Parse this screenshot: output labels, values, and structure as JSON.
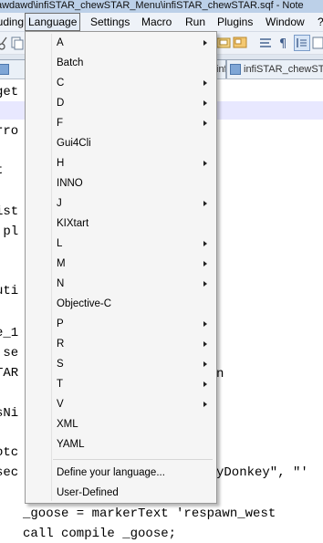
{
  "window": {
    "title": "awdawd\\infiSTAR_chewSTAR_Menu\\infiSTAR_chewSTAR.sqf - Note"
  },
  "menubar": {
    "items": [
      {
        "label": "luding"
      },
      {
        "label": "Language"
      },
      {
        "label": "Settings"
      },
      {
        "label": "Macro"
      },
      {
        "label": "Run"
      },
      {
        "label": "Plugins"
      },
      {
        "label": "Window"
      },
      {
        "label": "?"
      }
    ]
  },
  "tabs": [
    {
      "label": "infiSTAR_chewSTAR..."
    },
    {
      "label": "infiSTAR_chewST"
    }
  ],
  "editor": {
    "lines": [
      "get",
      "",
      "rro",
      "",
      "t",
      "",
      "ist",
      " pl",
      "",
      "",
      "uti",
      "",
      "e_1",
      " se",
      "TAR",
      "",
      "sNi",
      "",
      "otc",
      "sec",
      "",
      "_goose = markerText 'respawn_west",
      "call compile _goose;"
    ],
    "fragments": [
      {
        "text": "n"
      },
      {
        "text": "yDonkey\", \"'"
      }
    ]
  },
  "language_menu": {
    "items": [
      {
        "label": "A",
        "submenu": true
      },
      {
        "label": "Batch",
        "submenu": false
      },
      {
        "label": "C",
        "submenu": true
      },
      {
        "label": "D",
        "submenu": true
      },
      {
        "label": "F",
        "submenu": true
      },
      {
        "label": "Gui4Cli",
        "submenu": false
      },
      {
        "label": "H",
        "submenu": true
      },
      {
        "label": "INNO",
        "submenu": false
      },
      {
        "label": "J",
        "submenu": true
      },
      {
        "label": "KIXtart",
        "submenu": false
      },
      {
        "label": "L",
        "submenu": true
      },
      {
        "label": "M",
        "submenu": true
      },
      {
        "label": "N",
        "submenu": true
      },
      {
        "label": "Objective-C",
        "submenu": false
      },
      {
        "label": "P",
        "submenu": true
      },
      {
        "label": "R",
        "submenu": true
      },
      {
        "label": "S",
        "submenu": true
      },
      {
        "label": "T",
        "submenu": true
      },
      {
        "label": "V",
        "submenu": true
      },
      {
        "label": "XML",
        "submenu": false
      },
      {
        "label": "YAML",
        "submenu": false
      }
    ],
    "footer_items": [
      {
        "label": "Define your language..."
      },
      {
        "label": "User-Defined"
      }
    ]
  }
}
